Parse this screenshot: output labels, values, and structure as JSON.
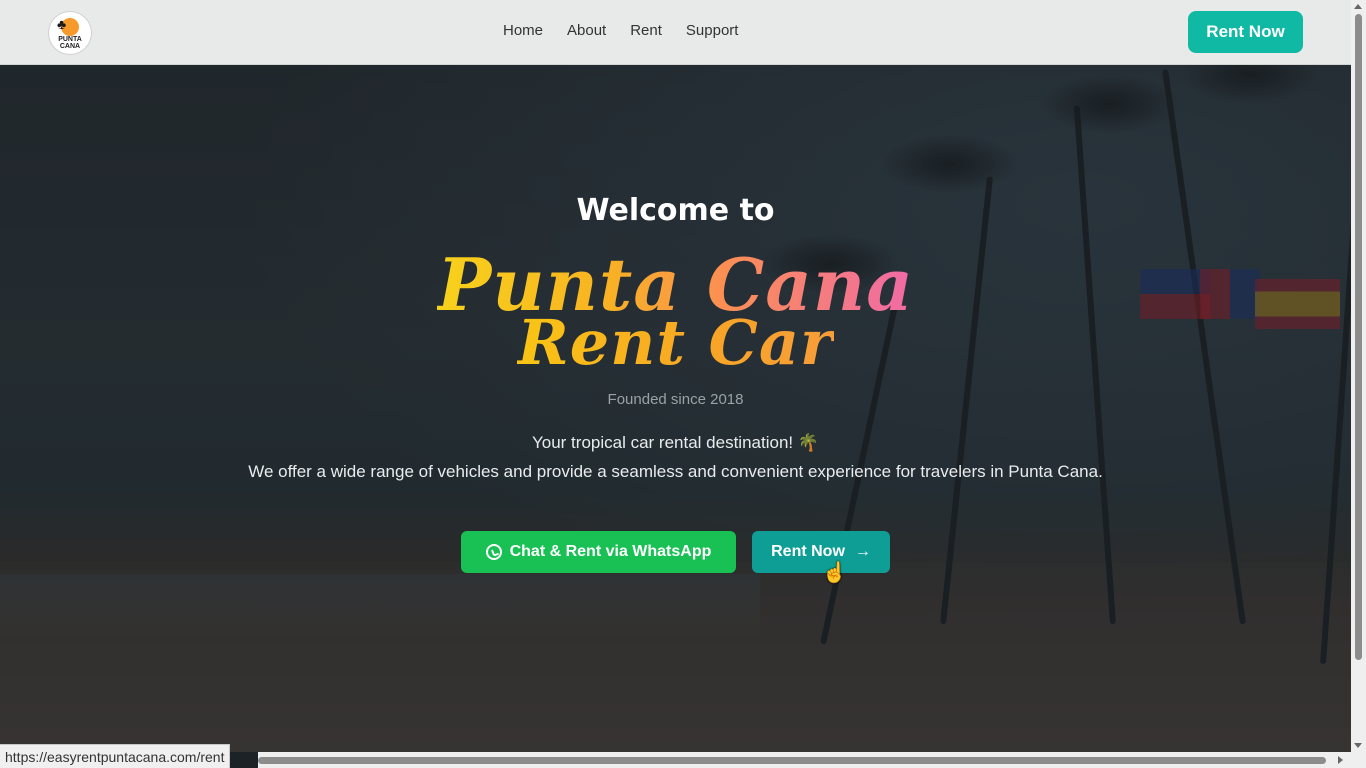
{
  "header": {
    "logo_text": "PUNTA CANA",
    "nav": [
      {
        "label": "Home"
      },
      {
        "label": "About"
      },
      {
        "label": "Rent"
      },
      {
        "label": "Support"
      }
    ],
    "cta_label": "Rent Now"
  },
  "hero": {
    "welcome": "Welcome to",
    "brand_line1": "Punta Cana",
    "brand_line2": "Rent Car",
    "founded": "Founded since 2018",
    "tagline1": "Your tropical car rental destination! 🌴",
    "tagline2": "We offer a wide range of vehicles and provide a seamless and convenient experience for travelers in Punta Cana.",
    "whatsapp_button": "Chat & Rent via WhatsApp",
    "rent_button": "Rent Now",
    "rent_arrow": "→"
  },
  "status_url": "https://easyrentpuntacana.com/rent",
  "colors": {
    "accent": "#0fb9a3",
    "whatsapp": "#19c155",
    "rent_button": "#0f9e96"
  },
  "icons": {
    "whatsapp": "whatsapp-icon",
    "arrow": "arrow-right-icon",
    "cursor": "hand-pointer-icon"
  }
}
